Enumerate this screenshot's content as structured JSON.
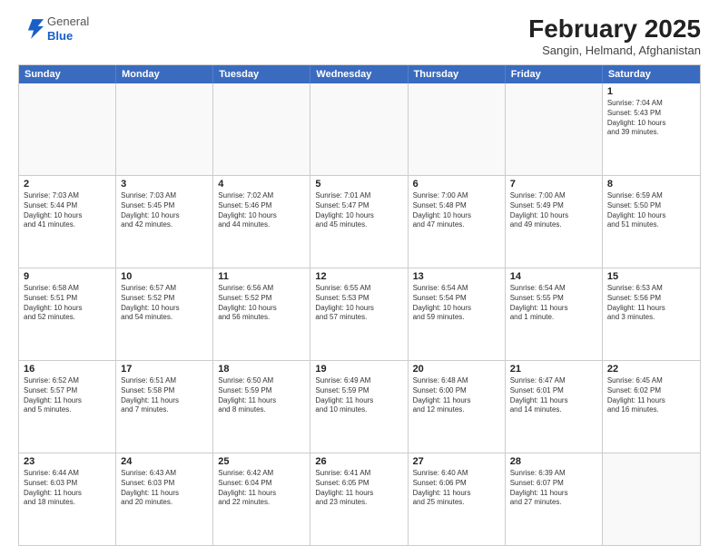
{
  "header": {
    "logo_general": "General",
    "logo_blue": "Blue",
    "month_year": "February 2025",
    "location": "Sangin, Helmand, Afghanistan"
  },
  "weekdays": [
    "Sunday",
    "Monday",
    "Tuesday",
    "Wednesday",
    "Thursday",
    "Friday",
    "Saturday"
  ],
  "weeks": [
    [
      {
        "day": "",
        "text": ""
      },
      {
        "day": "",
        "text": ""
      },
      {
        "day": "",
        "text": ""
      },
      {
        "day": "",
        "text": ""
      },
      {
        "day": "",
        "text": ""
      },
      {
        "day": "",
        "text": ""
      },
      {
        "day": "1",
        "text": "Sunrise: 7:04 AM\nSunset: 5:43 PM\nDaylight: 10 hours\nand 39 minutes."
      }
    ],
    [
      {
        "day": "2",
        "text": "Sunrise: 7:03 AM\nSunset: 5:44 PM\nDaylight: 10 hours\nand 41 minutes."
      },
      {
        "day": "3",
        "text": "Sunrise: 7:03 AM\nSunset: 5:45 PM\nDaylight: 10 hours\nand 42 minutes."
      },
      {
        "day": "4",
        "text": "Sunrise: 7:02 AM\nSunset: 5:46 PM\nDaylight: 10 hours\nand 44 minutes."
      },
      {
        "day": "5",
        "text": "Sunrise: 7:01 AM\nSunset: 5:47 PM\nDaylight: 10 hours\nand 45 minutes."
      },
      {
        "day": "6",
        "text": "Sunrise: 7:00 AM\nSunset: 5:48 PM\nDaylight: 10 hours\nand 47 minutes."
      },
      {
        "day": "7",
        "text": "Sunrise: 7:00 AM\nSunset: 5:49 PM\nDaylight: 10 hours\nand 49 minutes."
      },
      {
        "day": "8",
        "text": "Sunrise: 6:59 AM\nSunset: 5:50 PM\nDaylight: 10 hours\nand 51 minutes."
      }
    ],
    [
      {
        "day": "9",
        "text": "Sunrise: 6:58 AM\nSunset: 5:51 PM\nDaylight: 10 hours\nand 52 minutes."
      },
      {
        "day": "10",
        "text": "Sunrise: 6:57 AM\nSunset: 5:52 PM\nDaylight: 10 hours\nand 54 minutes."
      },
      {
        "day": "11",
        "text": "Sunrise: 6:56 AM\nSunset: 5:52 PM\nDaylight: 10 hours\nand 56 minutes."
      },
      {
        "day": "12",
        "text": "Sunrise: 6:55 AM\nSunset: 5:53 PM\nDaylight: 10 hours\nand 57 minutes."
      },
      {
        "day": "13",
        "text": "Sunrise: 6:54 AM\nSunset: 5:54 PM\nDaylight: 10 hours\nand 59 minutes."
      },
      {
        "day": "14",
        "text": "Sunrise: 6:54 AM\nSunset: 5:55 PM\nDaylight: 11 hours\nand 1 minute."
      },
      {
        "day": "15",
        "text": "Sunrise: 6:53 AM\nSunset: 5:56 PM\nDaylight: 11 hours\nand 3 minutes."
      }
    ],
    [
      {
        "day": "16",
        "text": "Sunrise: 6:52 AM\nSunset: 5:57 PM\nDaylight: 11 hours\nand 5 minutes."
      },
      {
        "day": "17",
        "text": "Sunrise: 6:51 AM\nSunset: 5:58 PM\nDaylight: 11 hours\nand 7 minutes."
      },
      {
        "day": "18",
        "text": "Sunrise: 6:50 AM\nSunset: 5:59 PM\nDaylight: 11 hours\nand 8 minutes."
      },
      {
        "day": "19",
        "text": "Sunrise: 6:49 AM\nSunset: 5:59 PM\nDaylight: 11 hours\nand 10 minutes."
      },
      {
        "day": "20",
        "text": "Sunrise: 6:48 AM\nSunset: 6:00 PM\nDaylight: 11 hours\nand 12 minutes."
      },
      {
        "day": "21",
        "text": "Sunrise: 6:47 AM\nSunset: 6:01 PM\nDaylight: 11 hours\nand 14 minutes."
      },
      {
        "day": "22",
        "text": "Sunrise: 6:45 AM\nSunset: 6:02 PM\nDaylight: 11 hours\nand 16 minutes."
      }
    ],
    [
      {
        "day": "23",
        "text": "Sunrise: 6:44 AM\nSunset: 6:03 PM\nDaylight: 11 hours\nand 18 minutes."
      },
      {
        "day": "24",
        "text": "Sunrise: 6:43 AM\nSunset: 6:03 PM\nDaylight: 11 hours\nand 20 minutes."
      },
      {
        "day": "25",
        "text": "Sunrise: 6:42 AM\nSunset: 6:04 PM\nDaylight: 11 hours\nand 22 minutes."
      },
      {
        "day": "26",
        "text": "Sunrise: 6:41 AM\nSunset: 6:05 PM\nDaylight: 11 hours\nand 23 minutes."
      },
      {
        "day": "27",
        "text": "Sunrise: 6:40 AM\nSunset: 6:06 PM\nDaylight: 11 hours\nand 25 minutes."
      },
      {
        "day": "28",
        "text": "Sunrise: 6:39 AM\nSunset: 6:07 PM\nDaylight: 11 hours\nand 27 minutes."
      },
      {
        "day": "",
        "text": ""
      }
    ]
  ]
}
